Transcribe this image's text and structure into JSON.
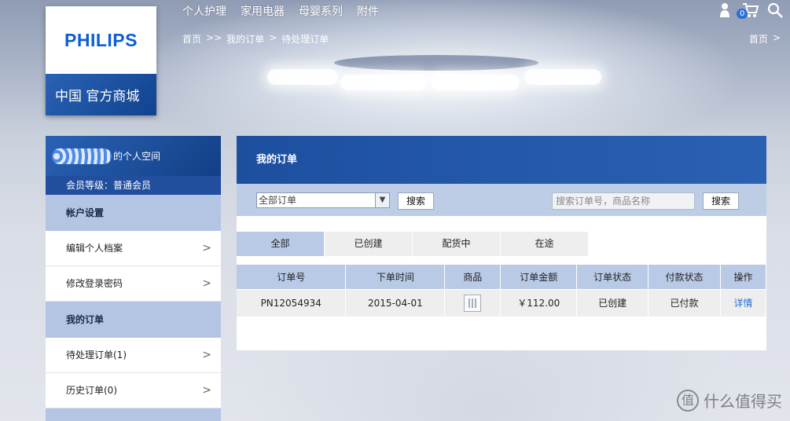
{
  "logo": {
    "brand": "PHILIPS",
    "subtitle": "中国 官方商城"
  },
  "topnav": [
    "个人护理",
    "家用电器",
    "母婴系列",
    "附件"
  ],
  "breadcrumb": {
    "home": "首页",
    "sep1": ">>",
    "orders": "我的订单",
    "sep2": ">",
    "current": "待处理订单"
  },
  "header_right": {
    "home": "首页",
    "chevron": ">",
    "cart_count": "0"
  },
  "icons": {
    "user": "user-icon",
    "cart": "cart-icon",
    "search": "search-icon"
  },
  "sidebar": {
    "user_space": "的个人空间",
    "member_level": "会员等级：普通会员",
    "sections": [
      {
        "title": "帐户设置",
        "items": [
          "编辑个人档案",
          "修改登录密码"
        ]
      },
      {
        "title": "我的订单",
        "items": [
          "待处理订单(1)",
          "历史订单(0)"
        ]
      }
    ],
    "chevron": ">"
  },
  "main": {
    "title": "我的订单",
    "filter": {
      "select_value": "全部订单",
      "search_button": "搜索",
      "search_placeholder": "搜索订单号，商品名称",
      "search_button2": "搜索"
    },
    "tabs": [
      "全部",
      "已创建",
      "配货中",
      "在途"
    ],
    "table": {
      "headers": [
        "订单号",
        "下单时间",
        "商品",
        "订单金额",
        "订单状态",
        "付款状态",
        "操作"
      ],
      "rows": [
        {
          "order_no": "PN12054934",
          "date": "2015-04-01",
          "amount": "￥112.00",
          "order_status": "已创建",
          "pay_status": "已付款",
          "action": "详情"
        }
      ]
    }
  },
  "watermark": {
    "text": "什么值得买",
    "logo_char": "值"
  },
  "colors": {
    "accent": "#1d4f9f",
    "light_blue": "#b9cae6",
    "link": "#2a6ed6"
  }
}
